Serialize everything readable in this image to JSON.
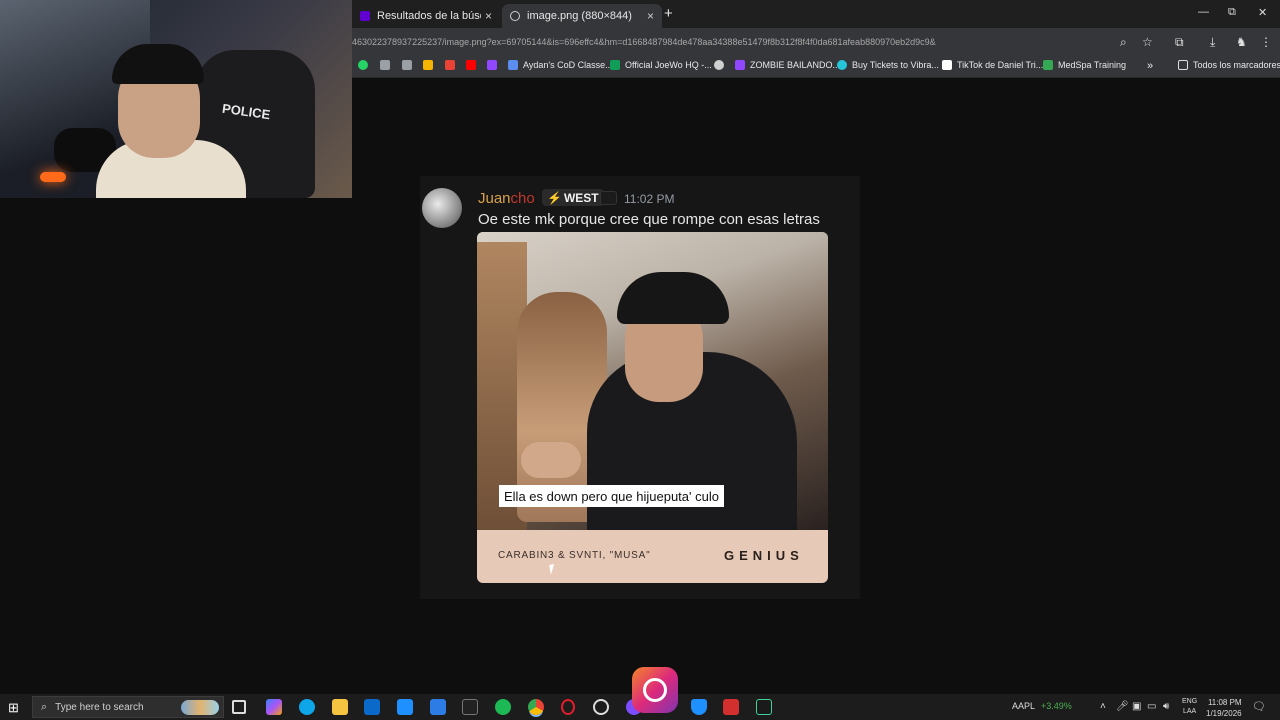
{
  "browser": {
    "tabs": [
      {
        "label": "Resultados de la búsqueda de",
        "close": "×"
      },
      {
        "label": "image.png (880×844)",
        "close": "×"
      }
    ],
    "new_tab": "+",
    "window_controls": {
      "minimize": "—",
      "restore": "⧉",
      "close": "✕"
    },
    "url": "463022378937225237/image.png?ex=69705144&is=696effc4&hm=d1668487984de478aa34388e51479f8b312f8f4f0da681afeab880970eb2d9c9&",
    "bookmarks": [
      {
        "label": "",
        "icon": "whatsapp-icon",
        "color": "#25d366"
      },
      {
        "label": "",
        "icon": "box-icon",
        "color": "#9aa0a6"
      },
      {
        "label": "",
        "icon": "grid-icon",
        "color": "#9aa0a6"
      },
      {
        "label": "",
        "icon": "bookmark-yellow-icon",
        "color": "#f5b400"
      },
      {
        "label": "",
        "icon": "gmail-icon",
        "color": "#ea4335"
      },
      {
        "label": "",
        "icon": "youtube-icon",
        "color": "#ff0000"
      },
      {
        "label": "",
        "icon": "twitch-icon",
        "color": "#9146ff"
      },
      {
        "label": "Aydan's CoD Classe...",
        "icon": "cod-icon",
        "color": "#5b8def"
      },
      {
        "label": "Official JoeWo HQ -...",
        "icon": "sheets-icon",
        "color": "#0f9d58"
      },
      {
        "label": "",
        "icon": "pin-icon",
        "color": "#d0d0d0"
      },
      {
        "label": "ZOMBIE BAILANDO...",
        "icon": "twitch-icon",
        "color": "#9146ff"
      },
      {
        "label": "Buy Tickets to Vibra...",
        "icon": "ticket-icon",
        "color": "#26c6da"
      },
      {
        "label": "TikTok de Daniel Tri...",
        "icon": "tiktok-icon",
        "color": "#ffffff"
      },
      {
        "label": "MedSpa Training",
        "icon": "drive-icon",
        "color": "#34a853"
      }
    ],
    "more_bookmarks": "»",
    "all_bookmarks": "Todos los marcadores"
  },
  "message": {
    "username_part1": "Juan",
    "username_part2": "cho",
    "badge": "WEST",
    "badge_icon": "⚡",
    "timestamp": "11:02 PM",
    "text": "Oe este mk porque cree que rompe con esas letras"
  },
  "embed": {
    "lyric": "Ella es down pero que hijueputa' culo",
    "song": "CARABIN3 & SVNTI, \"MUSA\"",
    "brand": "GENIUS"
  },
  "webcam": {
    "chair_text": "POLICE"
  },
  "taskbar": {
    "search_placeholder": "Type here to search",
    "stock_symbol": "AAPL",
    "stock_change": "+3.49%",
    "lang_line1": "ENG",
    "lang_line2": "LAA",
    "time": "11:08 PM",
    "date": "1/19/2026"
  }
}
